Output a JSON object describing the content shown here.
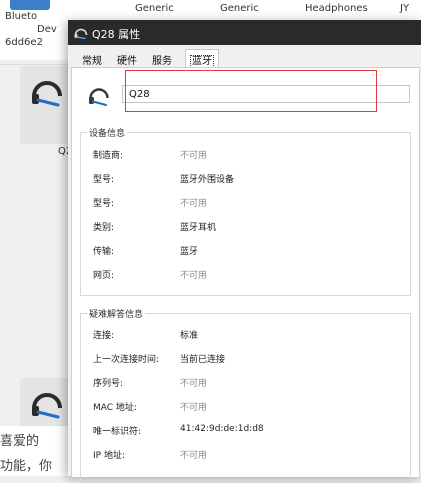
{
  "background": {
    "device_caption_1": "Blueto",
    "device_caption_2": "Dev",
    "device_caption_3": "6dd6e2",
    "col_generic_1": "Generic",
    "col_generic_2": "Generic",
    "col_headphones": "Headphones",
    "col_jy": "JY",
    "tile_label": "Q2",
    "text_line_1": "喜爱的",
    "text_line_2": "功能，你"
  },
  "dialog": {
    "title": "Q28 属性",
    "tabs": [
      {
        "label": "常规"
      },
      {
        "label": "硬件"
      },
      {
        "label": "服务"
      },
      {
        "label": "蓝牙"
      }
    ],
    "device_name_value": "Q28",
    "device_info": {
      "title": "设备信息",
      "rows": [
        {
          "label": "制造商:",
          "value": "不可用"
        },
        {
          "label": "型号:",
          "value": "蓝牙外围设备"
        },
        {
          "label": "型号:",
          "value": "不可用"
        },
        {
          "label": "类别:",
          "value": "蓝牙耳机"
        },
        {
          "label": "传输:",
          "value": "蓝牙"
        },
        {
          "label": "网页:",
          "value": "不可用"
        }
      ]
    },
    "troubleshooting": {
      "title": "疑难解答信息",
      "rows": [
        {
          "label": "连接:",
          "value": "标准"
        },
        {
          "label": "上一次连接时间:",
          "value": "当前已连接"
        },
        {
          "label": "序列号:",
          "value": "不可用"
        },
        {
          "label": "MAC 地址:",
          "value": "不可用"
        },
        {
          "label": "唯一标识符:",
          "value": "41:42:9d:de:1d:d8"
        },
        {
          "label": "IP 地址:",
          "value": "不可用"
        }
      ]
    }
  },
  "icons": {
    "title_icon": "headset-icon",
    "device_icon": "headset-icon",
    "background_device_icon": "headset-icon"
  },
  "colors": {
    "titlebar_bg": "#2a2a2a",
    "highlight": "#e23a3a",
    "muted_text": "#8a8a8a",
    "device_icon_accent": "#1f6fc5"
  }
}
